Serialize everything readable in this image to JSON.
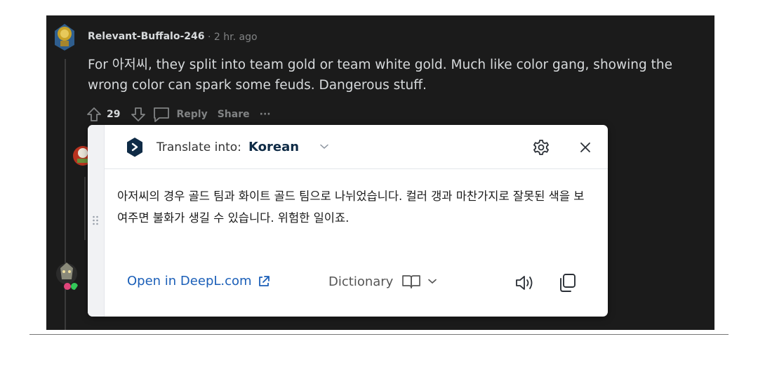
{
  "comment": {
    "author": "Relevant-Buffalo-246",
    "meta": "· 2 hr. ago",
    "body": "For 아저씨, they split into team gold or team white gold. Much like color gang, showing the wrong color can spark some feuds. Dangerous stuff.",
    "votes": "29",
    "reply_label": "Reply",
    "share_label": "Share",
    "more_label": "···"
  },
  "translator": {
    "translate_label": "Translate into:",
    "target_language": "Korean",
    "translation": "아저씨의 경우 골드 팀과 화이트 골드 팀으로 나뉘었습니다. 컬러 갱과 마찬가지로 잘못된 색을 보여주면 불화가 생길 수 있습니다. 위험한 일이죠.",
    "open_link_label": "Open in DeepL.com",
    "dictionary_label": "Dictionary"
  },
  "icons": {
    "logo": "deepl-logo-icon",
    "settings": "gear-icon",
    "close": "close-icon",
    "external": "external-link-icon",
    "book": "book-icon",
    "speaker": "speaker-icon",
    "copy": "copy-icon",
    "upvote": "upvote-arrow-icon",
    "downvote": "downvote-arrow-icon",
    "reply": "comment-bubble-icon"
  },
  "colors": {
    "background": "#1b1b1b",
    "comment_text": "#d7dadc",
    "muted_text": "#818384",
    "link": "#1b5fb8",
    "language": "#0f2b46",
    "deepl_logo": "#0f2b46"
  }
}
